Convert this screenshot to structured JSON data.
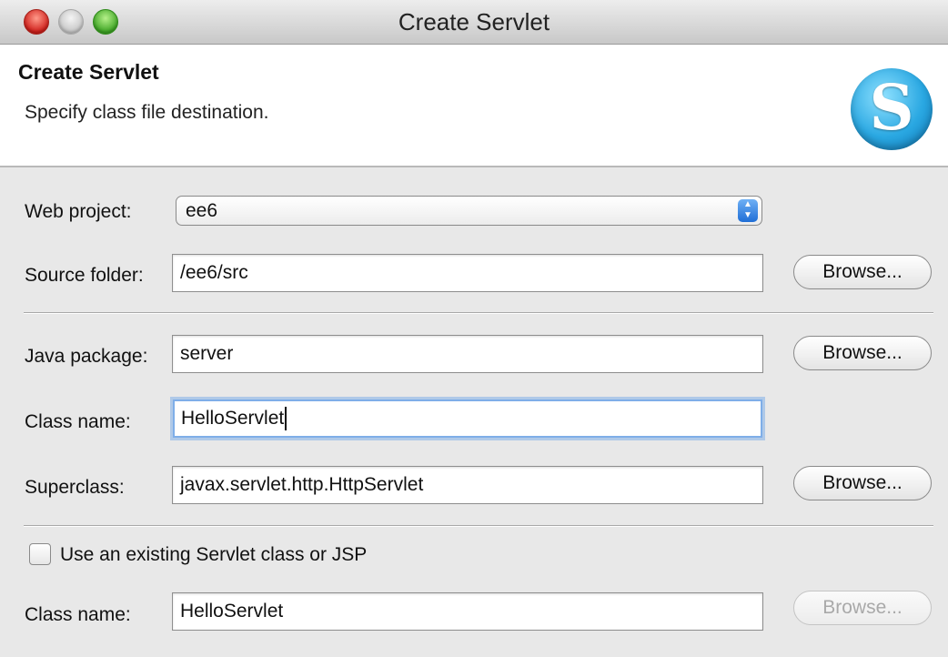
{
  "window": {
    "title": "Create Servlet"
  },
  "banner": {
    "title": "Create Servlet",
    "subtitle": "Specify class file destination.",
    "logo_glyph": "S",
    "logo_icon": "servlet-logo-icon"
  },
  "web_project": {
    "label": "Web project:",
    "value": "ee6"
  },
  "source_folder": {
    "label": "Source folder:",
    "value": "/ee6/src",
    "browse_label": "Browse..."
  },
  "java_package": {
    "label": "Java package:",
    "value": "server",
    "browse_label": "Browse..."
  },
  "class_name": {
    "label": "Class name:",
    "value": "HelloServlet"
  },
  "superclass": {
    "label": "Superclass:",
    "value": "javax.servlet.http.HttpServlet",
    "browse_label": "Browse..."
  },
  "existing": {
    "checkbox_label": "Use an existing Servlet class or JSP",
    "checked": false,
    "class_label": "Class name:",
    "class_value": "HelloServlet",
    "browse_label": "Browse..."
  },
  "colors": {
    "focus_ring": "#7faee8",
    "close_light": "#d0201b",
    "max_light": "#3ea524",
    "logo": "#2aa8e2"
  }
}
